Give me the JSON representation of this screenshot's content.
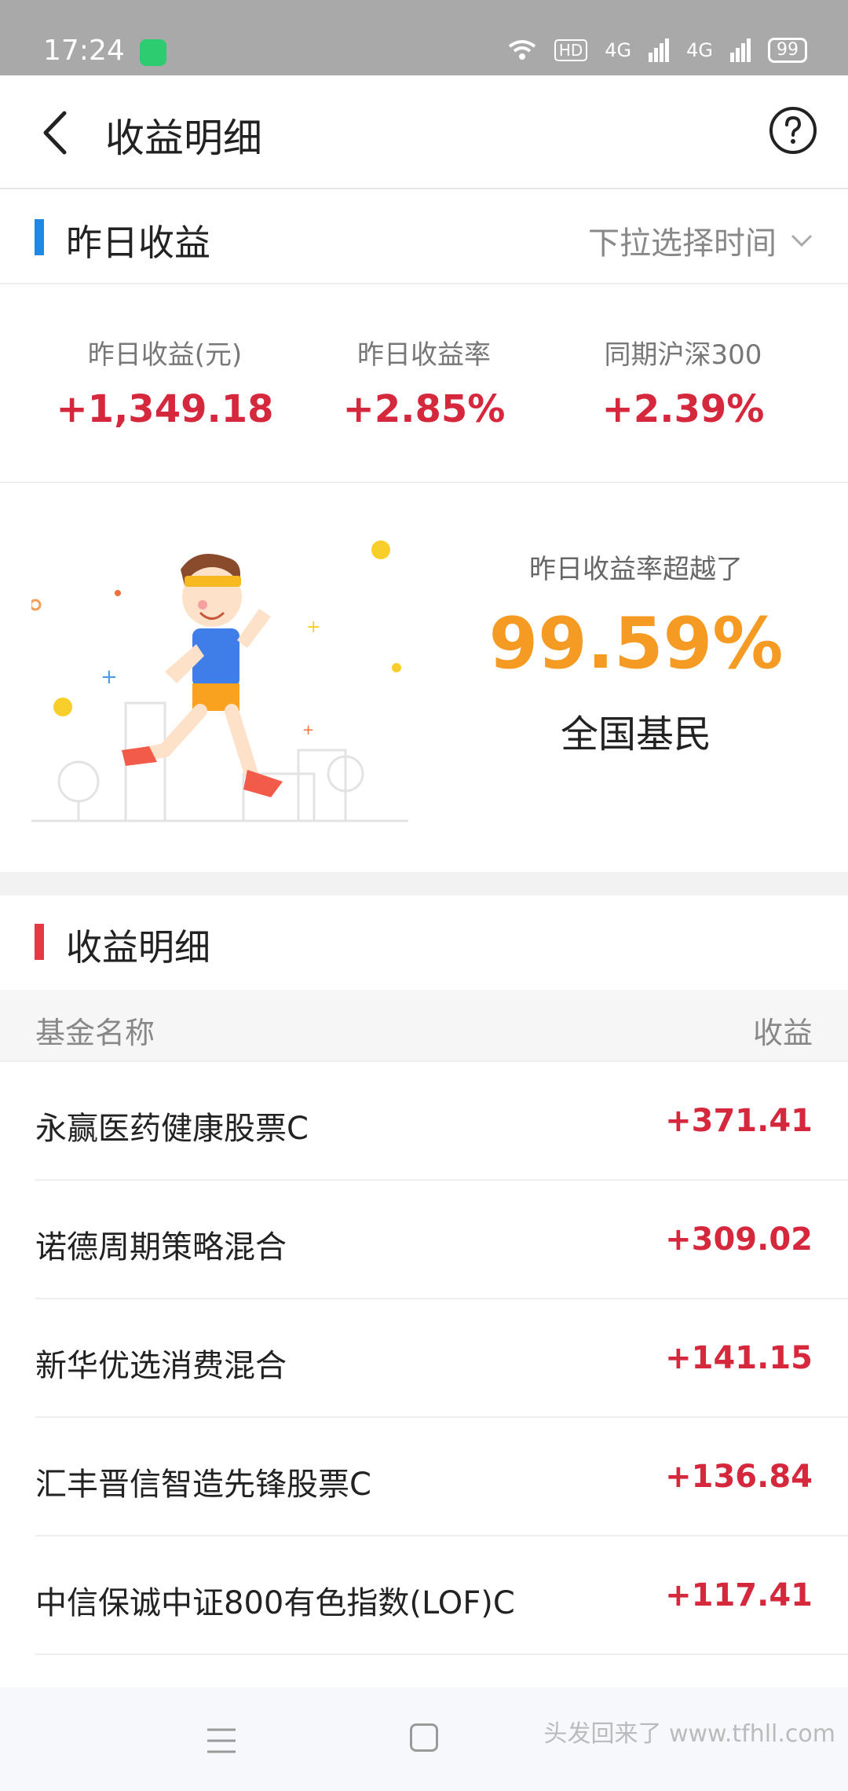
{
  "status_bar": {
    "time": "17:24",
    "network_1": "4G",
    "network_2": "4G",
    "hd": "HD",
    "battery": "99"
  },
  "app_bar": {
    "title": "收益明细",
    "back_icon": "chevron-left-icon",
    "help_icon": "question-circle-icon"
  },
  "yesterday": {
    "section_title": "昨日收益",
    "accent": "#1e88e5",
    "time_picker_label": "下拉选择时间",
    "stats": [
      {
        "caption": "昨日收益(元)",
        "value": "+1,349.18"
      },
      {
        "caption": "昨日收益率",
        "value": "+2.85%"
      },
      {
        "caption": "同期沪深300",
        "value": "+2.39%"
      }
    ]
  },
  "rank": {
    "caption": "昨日收益率超越了",
    "percent": "99.59%",
    "who": "全国基民"
  },
  "details": {
    "section_title": "收益明细",
    "accent": "#e53946",
    "col_name": "基金名称",
    "col_income": "收益",
    "rows": [
      {
        "name": "永赢医药健康股票C",
        "amount": "+371.41"
      },
      {
        "name": "诺德周期策略混合",
        "amount": "+309.02"
      },
      {
        "name": "新华优选消费混合",
        "amount": "+141.15"
      },
      {
        "name": "汇丰晋信智造先锋股票C",
        "amount": "+136.84"
      },
      {
        "name": "中信保诚中证800有色指数(LOF)C",
        "amount": "+117.41"
      }
    ]
  },
  "nav": {
    "watermark": "头发回来了 www.tfhll.com"
  },
  "colors": {
    "positive": "#d6283d",
    "rank_highlight": "#f59a23"
  }
}
